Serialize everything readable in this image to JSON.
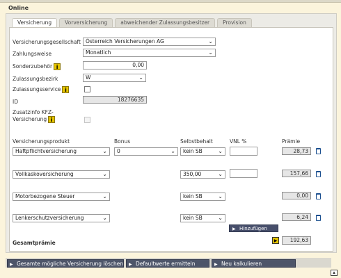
{
  "section_title": "Online",
  "tabs": [
    {
      "label": "Versicherung",
      "active": true
    },
    {
      "label": "Vorversicherung",
      "active": false
    },
    {
      "label": "abweichender Zulassungsbesitzer",
      "active": false
    },
    {
      "label": "Provision",
      "active": false
    }
  ],
  "form": {
    "gesellschaft": {
      "label": "Versicherungsgesellschaft",
      "value": "Österreich Versicherungen AG"
    },
    "zahlungsweise": {
      "label": "Zahlungsweise",
      "value": "Monatlich"
    },
    "sonderzubehoer": {
      "label": "Sonderzubehör",
      "value": "0,00"
    },
    "zulassungsbezirk": {
      "label": "Zulassungsbezirk",
      "value": "W"
    },
    "zulassungsservice": {
      "label": "Zulassungsservice",
      "checked": false
    },
    "id": {
      "label": "ID",
      "value": "18276635"
    },
    "zusatzinfo": {
      "label_line1": "Zusatzinfo KFZ-",
      "label_line2": "Versicherung",
      "checked": false
    }
  },
  "table": {
    "headers": {
      "produkt": "Versicherungsprodukt",
      "bonus": "Bonus",
      "selbstbehalt": "Selbstbehalt",
      "vnl": "VNL %",
      "praemie": "Prämie"
    },
    "rows": [
      {
        "produkt": "Haftpflichtversicherung",
        "bonus": "0",
        "selbstbehalt": "kein SB",
        "vnl": "",
        "praemie": "28,73"
      },
      {
        "produkt": "Vollkaskoversicherung",
        "bonus": "",
        "selbstbehalt": "350,00",
        "vnl": "",
        "praemie": "157,66"
      },
      {
        "produkt": "Motorbezogene Steuer",
        "bonus": "",
        "selbstbehalt": "kein SB",
        "vnl": "",
        "praemie": "0,00"
      },
      {
        "produkt": "Lenkerschutzversicherung",
        "bonus": "",
        "selbstbehalt": "kein SB",
        "vnl": "",
        "praemie": "6,24"
      }
    ],
    "add_label": "Hinzufügen",
    "total_label": "Gesamtprämie",
    "total_value": "192,63"
  },
  "bottom_buttons": {
    "delete_all": "Gesamte mögliche Versicherung löschen",
    "defaults": "Defaultwerte ermitteln",
    "recalc": "Neu kalkulieren"
  },
  "icons": {
    "info": "info-icon",
    "trash": "trash-icon",
    "arrow": "arrow-right-icon"
  },
  "colors": {
    "background": "#fbf4dc",
    "button": "#4d5569",
    "info": "#e5c400"
  }
}
